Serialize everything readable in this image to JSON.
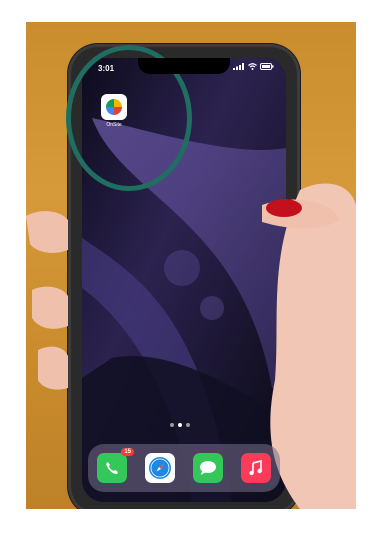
{
  "status_bar": {
    "time": "3:01"
  },
  "home_screen": {
    "apps": [
      {
        "label": "OnSite",
        "icon": "color-wheel-app-icon"
      }
    ],
    "page_indicator": {
      "count": 3,
      "active": 2
    }
  },
  "dock": {
    "apps": [
      {
        "name": "phone",
        "icon": "phone-icon",
        "color": "#34c759",
        "badge": "15"
      },
      {
        "name": "safari",
        "icon": "safari-icon",
        "color": "#1e88e5"
      },
      {
        "name": "messages",
        "icon": "messages-icon",
        "color": "#34c759"
      },
      {
        "name": "music",
        "icon": "music-icon",
        "color": "#fa3c5a"
      }
    ]
  },
  "annotation": {
    "highlight_color": "#1f6e61"
  }
}
